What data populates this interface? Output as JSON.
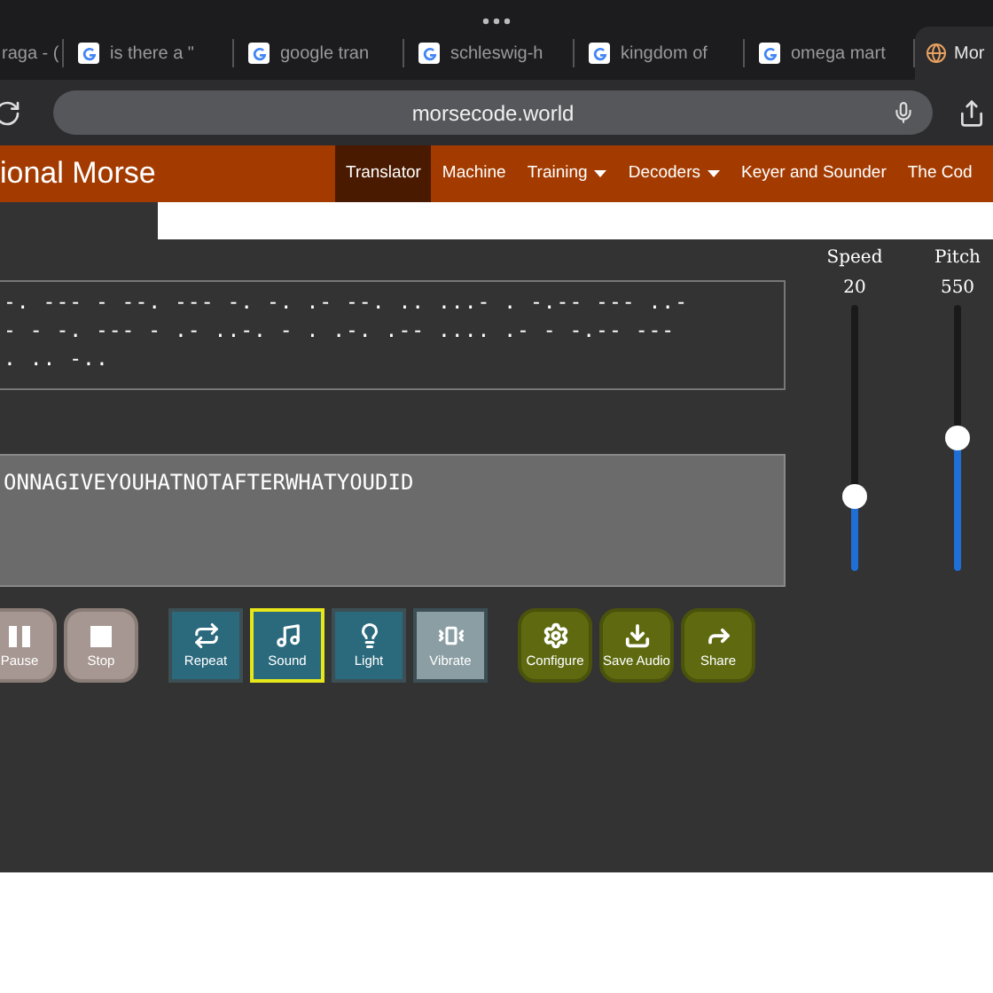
{
  "browser": {
    "tabs": [
      {
        "label": "raga - (",
        "selected": false,
        "kind": "plain"
      },
      {
        "label": "is there a \"",
        "selected": false,
        "kind": "google"
      },
      {
        "label": "google tran",
        "selected": false,
        "kind": "google"
      },
      {
        "label": "schleswig-h",
        "selected": false,
        "kind": "google"
      },
      {
        "label": "kingdom of",
        "selected": false,
        "kind": "google"
      },
      {
        "label": "omega mart",
        "selected": false,
        "kind": "google"
      },
      {
        "label": "Mor",
        "selected": true,
        "kind": "site"
      }
    ],
    "address": "morsecode.world"
  },
  "site": {
    "title": "ional Morse",
    "nav": [
      {
        "label": "Translator",
        "selected": true,
        "dropdown": false
      },
      {
        "label": "Machine",
        "selected": false,
        "dropdown": false
      },
      {
        "label": "Training",
        "selected": false,
        "dropdown": true
      },
      {
        "label": "Decoders",
        "selected": false,
        "dropdown": true
      },
      {
        "label": "Keyer and Sounder",
        "selected": false,
        "dropdown": false
      },
      {
        "label": "The Cod",
        "selected": false,
        "dropdown": false
      }
    ]
  },
  "morse_output": {
    "lines": [
      "-. --- - --. --- -. -. .- --. .. ...- . -.-- --- ..-",
      "- - -. --- - .- ..-. - . .-. .-- .... .- - -.-- ---",
      ". .. -.."
    ]
  },
  "text_input": {
    "value": "ONNAGIVEYOUHATNOTAFTERWHATYOUDID"
  },
  "sliders": [
    {
      "label": "Speed",
      "reading": "20",
      "level": 0.28
    },
    {
      "label": "Pitch",
      "reading": "550",
      "level": 0.5
    }
  ],
  "button_groups": [
    {
      "kind": "playback",
      "buttons": [
        {
          "label": "Pause",
          "kind": "pause",
          "selected": false,
          "disabled": false
        },
        {
          "label": "Stop",
          "kind": "stop",
          "selected": false,
          "disabled": false
        }
      ]
    },
    {
      "kind": "output",
      "buttons": [
        {
          "label": "Repeat",
          "kind": "repeat",
          "selected": false,
          "disabled": false
        },
        {
          "label": "Sound",
          "kind": "sound",
          "selected": true,
          "disabled": false
        },
        {
          "label": "Light",
          "kind": "light",
          "selected": false,
          "disabled": false
        },
        {
          "label": "Vibrate",
          "kind": "vibrate",
          "selected": false,
          "disabled": true
        }
      ]
    },
    {
      "kind": "actions",
      "buttons": [
        {
          "label": "Configure",
          "kind": "configure",
          "selected": false,
          "disabled": false
        },
        {
          "label": "Save Audio",
          "kind": "save",
          "selected": false,
          "disabled": false
        },
        {
          "label": "Share",
          "kind": "share",
          "selected": false,
          "disabled": false
        }
      ]
    }
  ]
}
